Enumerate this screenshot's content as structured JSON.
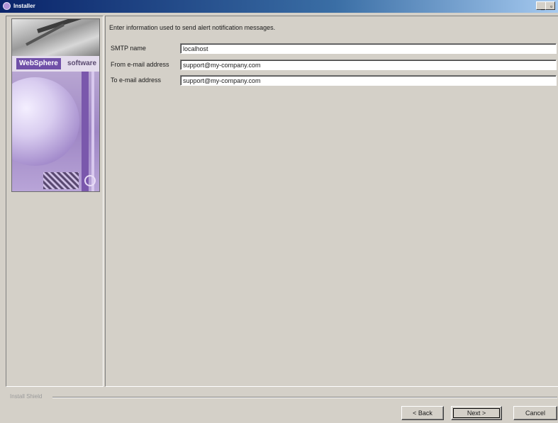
{
  "window": {
    "title": "Installer",
    "minimize_label": "_",
    "maximize_label": "▫"
  },
  "banner": {
    "brand_name": "WebSphere",
    "brand_suffix": "software"
  },
  "form": {
    "instruction": "Enter information used to send alert notification messages.",
    "fields": [
      {
        "label": "SMTP name",
        "value": "localhost"
      },
      {
        "label": "From e-mail address",
        "value": "support@my-company.com"
      },
      {
        "label": "To e-mail address",
        "value": "support@my-company.com"
      }
    ]
  },
  "footer": {
    "install_label": "Install Shield",
    "back_label": "< Back",
    "next_label": "Next >",
    "cancel_label": "Cancel"
  }
}
